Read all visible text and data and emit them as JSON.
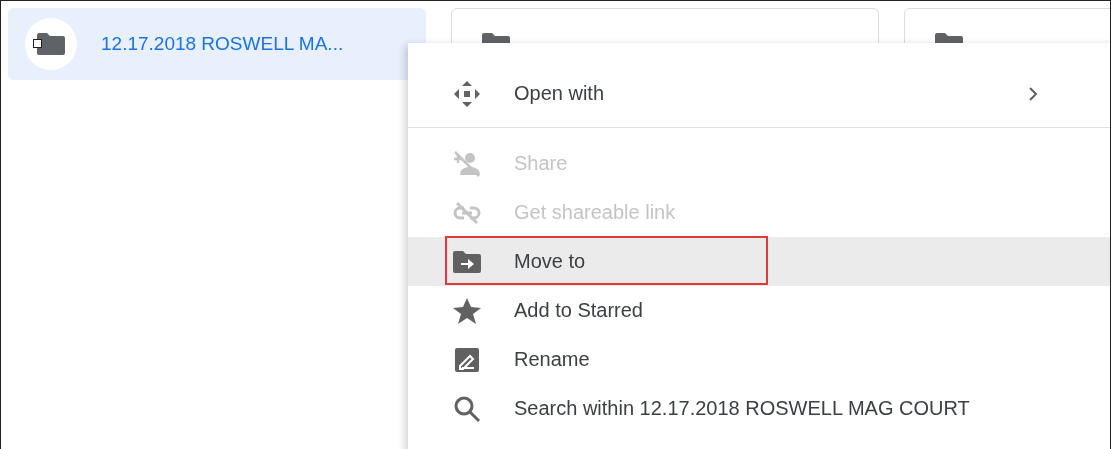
{
  "folders": [
    {
      "name": "12.17.2018 ROSWELL MA...",
      "selected": true
    },
    {
      "selected": false
    },
    {
      "selected": false
    }
  ],
  "context_menu": {
    "items": [
      {
        "label": "Open with",
        "disabled": false,
        "selected": false,
        "submenu": true,
        "divider_after": true
      },
      {
        "label": "Share",
        "disabled": true,
        "selected": false
      },
      {
        "label": "Get shareable link",
        "disabled": true,
        "selected": false
      },
      {
        "label": "Move to",
        "disabled": false,
        "selected": true,
        "outlined": true
      },
      {
        "label": "Add to Starred",
        "disabled": false,
        "selected": false
      },
      {
        "label": "Rename",
        "disabled": false,
        "selected": false
      },
      {
        "label": "Search within 12.17.2018 ROSWELL MAG COURT",
        "disabled": false,
        "selected": false
      }
    ]
  }
}
